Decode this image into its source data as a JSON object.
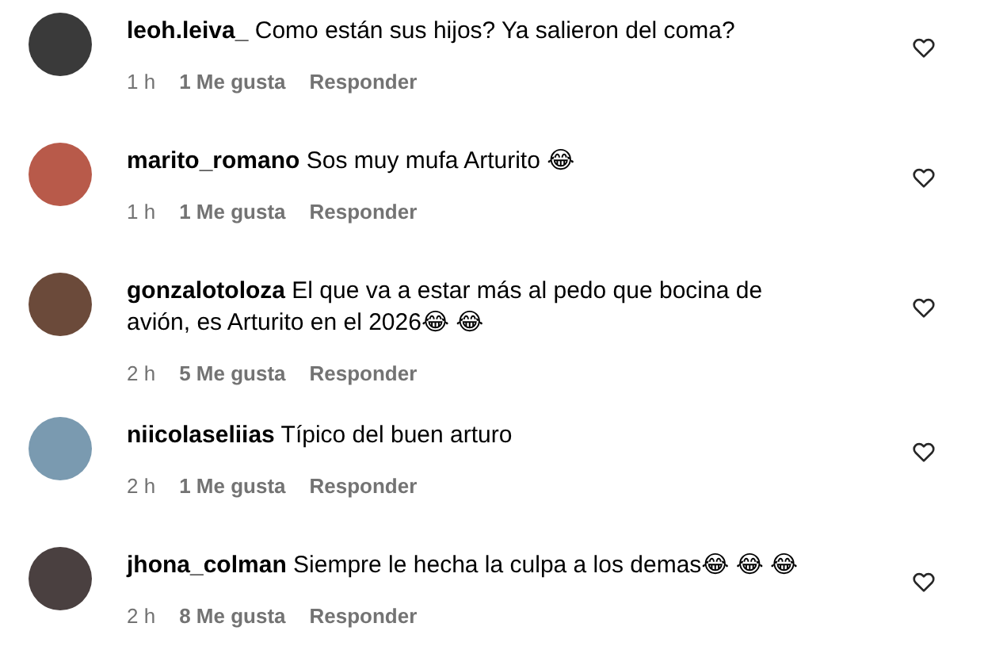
{
  "comments": [
    {
      "username": "leoh.leiva_",
      "text": "Como están sus hijos? Ya salieron del coma?",
      "time": "1 h",
      "likes": "1 Me gusta",
      "reply": "Responder"
    },
    {
      "username": "marito_romano",
      "text": "Sos muy mufa Arturito 😂",
      "time": "1 h",
      "likes": "1 Me gusta",
      "reply": "Responder"
    },
    {
      "username": "gonzalotoloza",
      "text": "El que va a estar más al pedo que bocina de avión, es Arturito en el 2026😂 😂",
      "time": "2 h",
      "likes": "5 Me gusta",
      "reply": "Responder"
    },
    {
      "username": "niicolaseliias",
      "text": "Típico del buen arturo",
      "time": "2 h",
      "likes": "1 Me gusta",
      "reply": "Responder"
    },
    {
      "username": "jhona_colman",
      "text": "Siempre le hecha la culpa a los demas😂 😂 😂",
      "time": "2 h",
      "likes": "8 Me gusta",
      "reply": "Responder"
    }
  ]
}
